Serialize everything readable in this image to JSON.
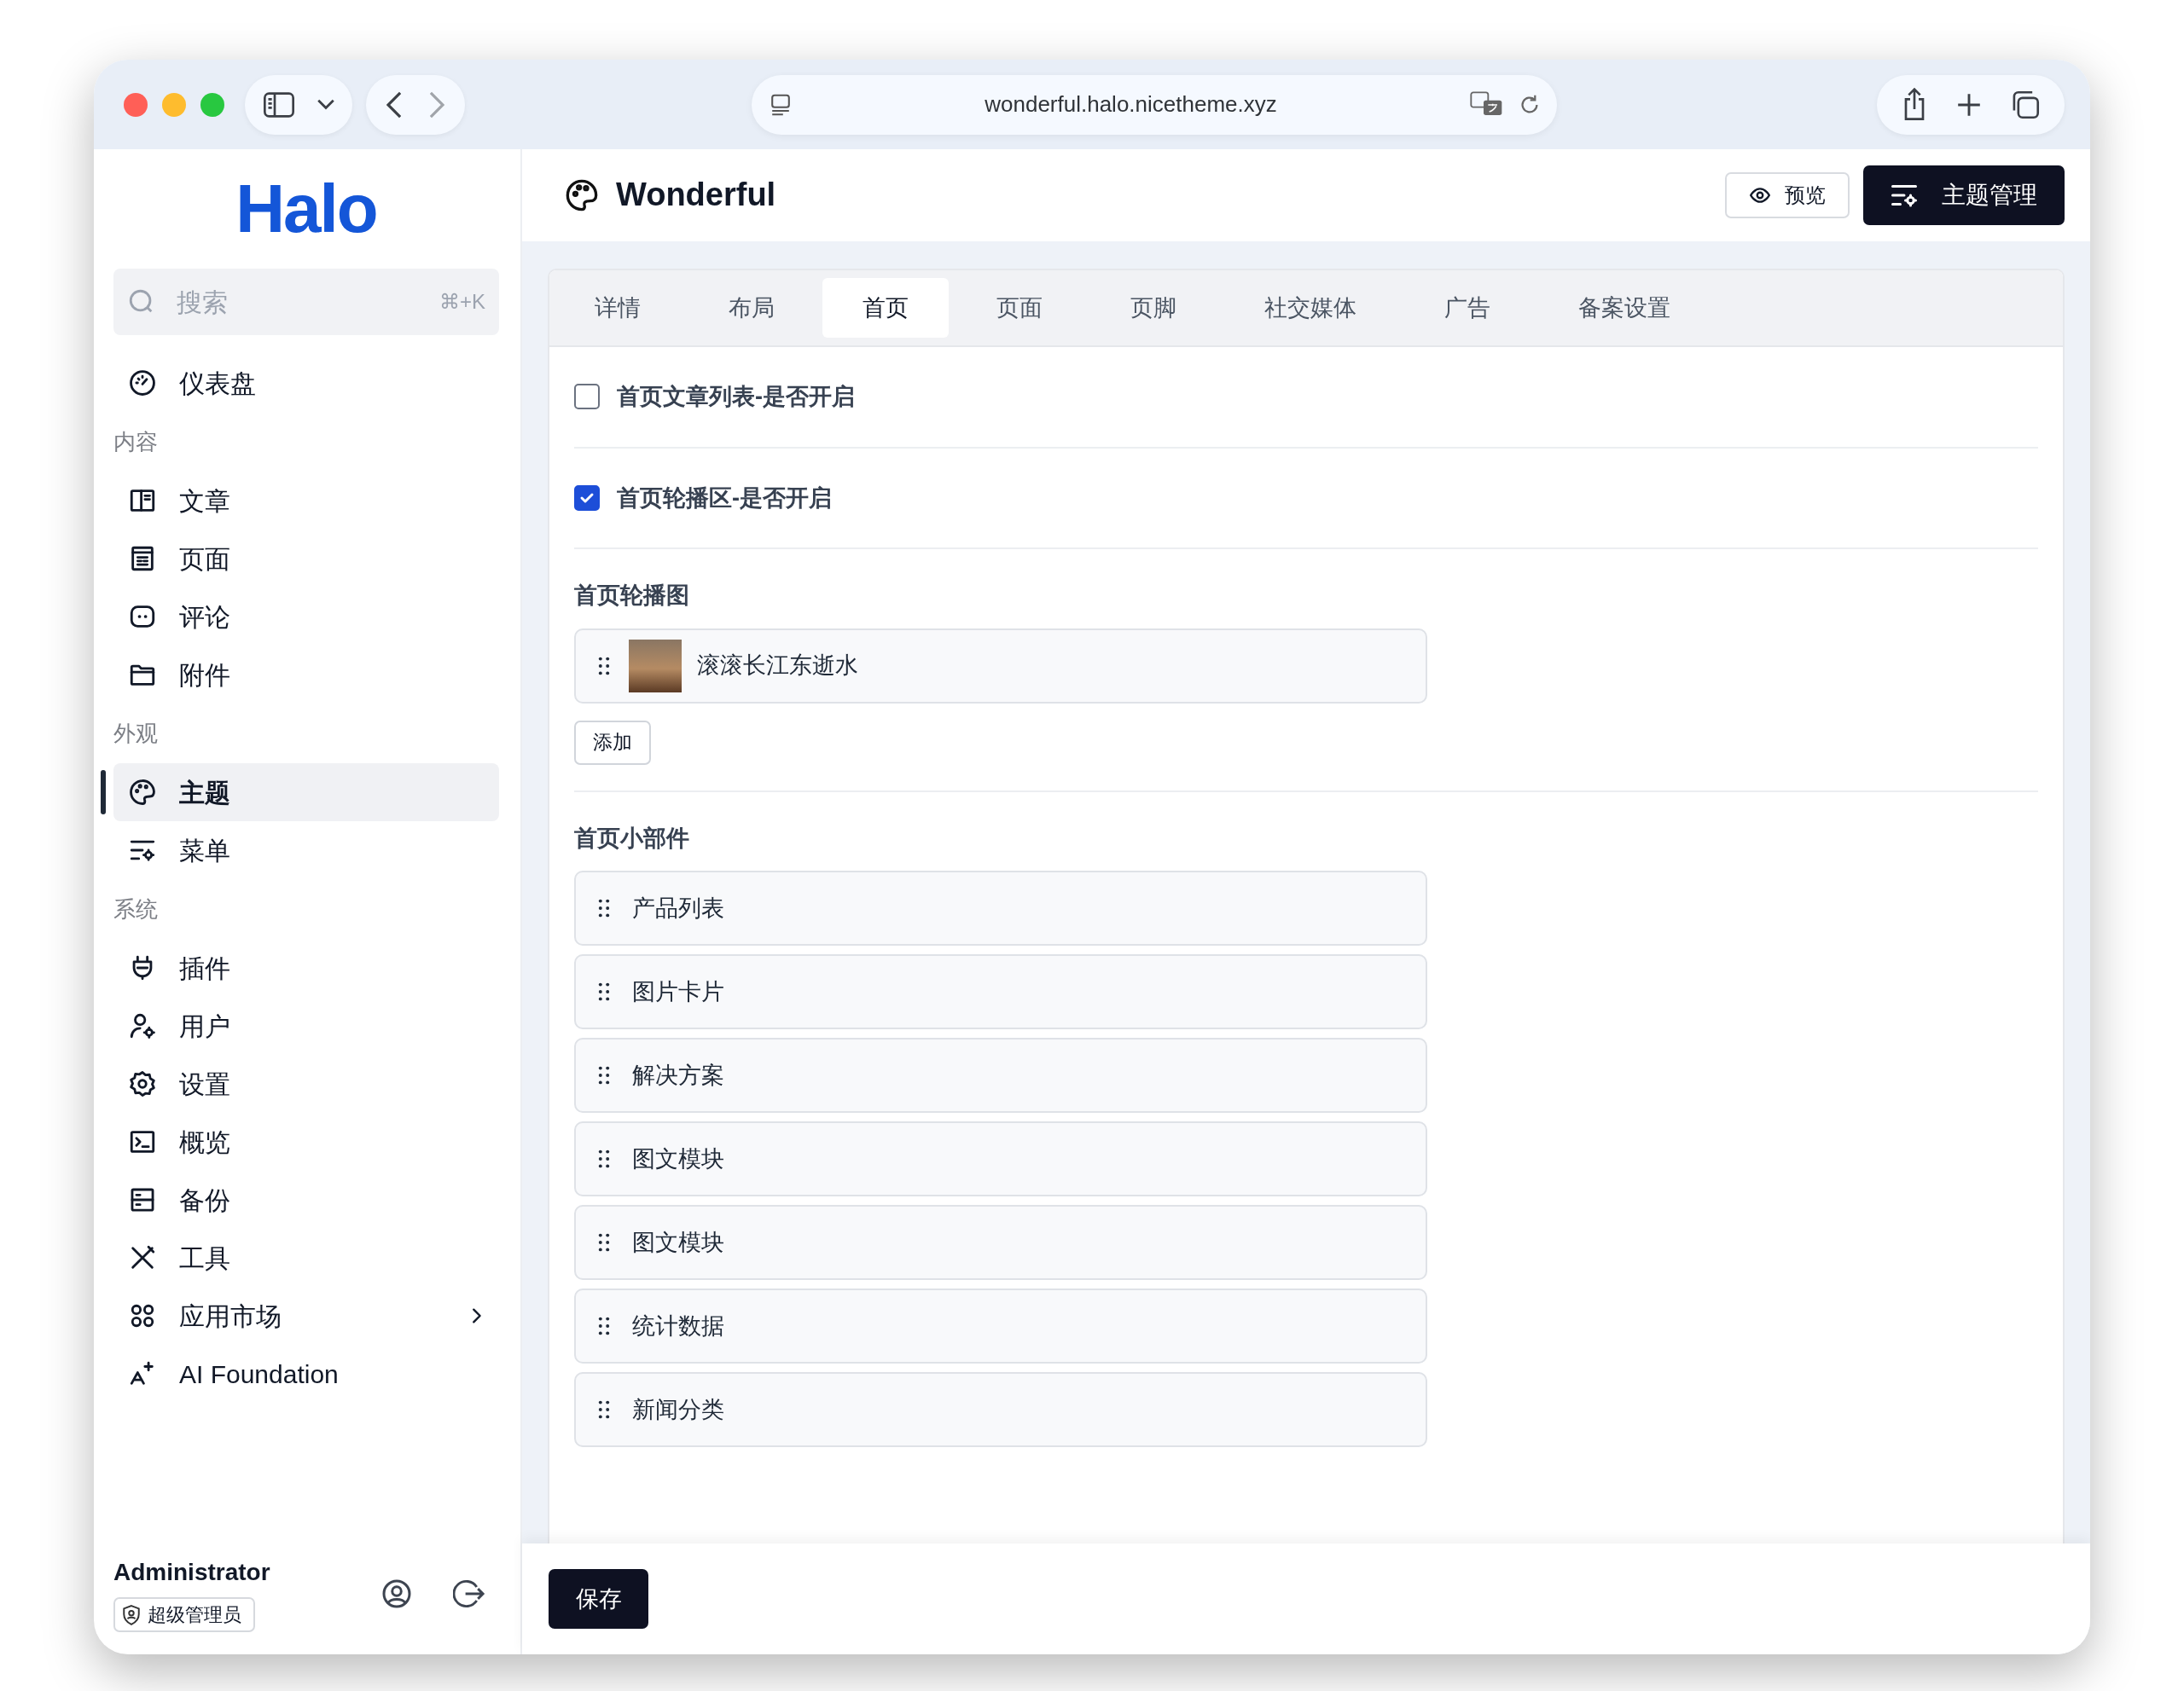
{
  "browser": {
    "address": "wonderful.halo.nicetheme.xyz"
  },
  "sidebar": {
    "logo": "Halo",
    "search": {
      "placeholder": "搜索",
      "shortcut": "⌘+K"
    },
    "groups": [
      {
        "items": [
          {
            "label": "仪表盘",
            "selected": false,
            "submenu": false
          }
        ]
      },
      {
        "title": "内容",
        "items": [
          {
            "label": "文章",
            "selected": false,
            "submenu": false
          },
          {
            "label": "页面",
            "selected": false,
            "submenu": false
          },
          {
            "label": "评论",
            "selected": false,
            "submenu": false
          },
          {
            "label": "附件",
            "selected": false,
            "submenu": false
          }
        ]
      },
      {
        "title": "外观",
        "items": [
          {
            "label": "主题",
            "selected": true,
            "submenu": false
          },
          {
            "label": "菜单",
            "selected": false,
            "submenu": false
          }
        ]
      },
      {
        "title": "系统",
        "items": [
          {
            "label": "插件",
            "selected": false,
            "submenu": false
          },
          {
            "label": "用户",
            "selected": false,
            "submenu": false
          },
          {
            "label": "设置",
            "selected": false,
            "submenu": false
          },
          {
            "label": "概览",
            "selected": false,
            "submenu": false
          },
          {
            "label": "备份",
            "selected": false,
            "submenu": false
          },
          {
            "label": "工具",
            "selected": false,
            "submenu": false
          },
          {
            "label": "应用市场",
            "selected": false,
            "submenu": true
          },
          {
            "label": "AI Foundation",
            "selected": false,
            "submenu": false
          }
        ]
      }
    ],
    "user": {
      "name": "Administrator",
      "role": "超级管理员"
    }
  },
  "header": {
    "title": "Wonderful",
    "buttons": [
      {
        "label": "预览",
        "kind": "secondary"
      },
      {
        "label": "主题管理",
        "kind": "primary"
      }
    ]
  },
  "tabs": [
    {
      "label": "详情",
      "selected": false
    },
    {
      "label": "布局",
      "selected": false
    },
    {
      "label": "首页",
      "selected": true
    },
    {
      "label": "页面",
      "selected": false
    },
    {
      "label": "页脚",
      "selected": false
    },
    {
      "label": "社交媒体",
      "selected": false
    },
    {
      "label": "广告",
      "selected": false
    },
    {
      "label": "备案设置",
      "selected": false
    }
  ],
  "form": {
    "fields": [
      {
        "kind": "checkbox",
        "label": "首页文章列表-是否开启",
        "checked": false
      },
      {
        "kind": "checkbox",
        "label": "首页轮播区-是否开启",
        "checked": true
      },
      {
        "kind": "image_list",
        "label": "首页轮播图",
        "items": [
          {
            "title": "滚滚长江东逝水"
          }
        ],
        "add_button": "添加"
      },
      {
        "kind": "sortable_list",
        "label": "首页小部件",
        "items": [
          {
            "title": "产品列表"
          },
          {
            "title": "图片卡片"
          },
          {
            "title": "解决方案"
          },
          {
            "title": "图文模块"
          },
          {
            "title": "图文模块"
          },
          {
            "title": "统计数据"
          },
          {
            "title": "新闻分类"
          }
        ]
      }
    ]
  },
  "save_button": "保存"
}
